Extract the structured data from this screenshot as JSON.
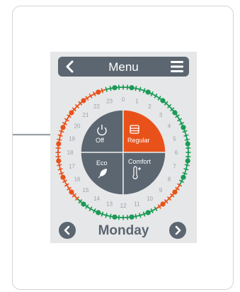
{
  "menu": {
    "title": "Menu"
  },
  "modes": {
    "off": "Off",
    "regular": "Regular",
    "eco": "Eco",
    "comfort": "Comfort"
  },
  "day": "Monday",
  "hours": [
    "0",
    "1",
    "2",
    "3",
    "4",
    "5",
    "6",
    "7",
    "8",
    "9",
    "10",
    "11",
    "12",
    "13",
    "14",
    "15",
    "16",
    "17",
    "18",
    "19",
    "20",
    "21",
    "22",
    "23"
  ],
  "colors": {
    "green": "#1a9a55",
    "orange": "#e8521a",
    "slate": "#5b6670",
    "regular_active": "#e8521a"
  },
  "schedule_mode_by_hour": [
    "green",
    "green",
    "green",
    "green",
    "green",
    "green",
    "green",
    "green",
    "orange",
    "orange",
    "green",
    "green",
    "green",
    "green",
    "green",
    "orange",
    "orange",
    "orange",
    "orange",
    "orange",
    "orange",
    "orange",
    "orange",
    "green"
  ]
}
